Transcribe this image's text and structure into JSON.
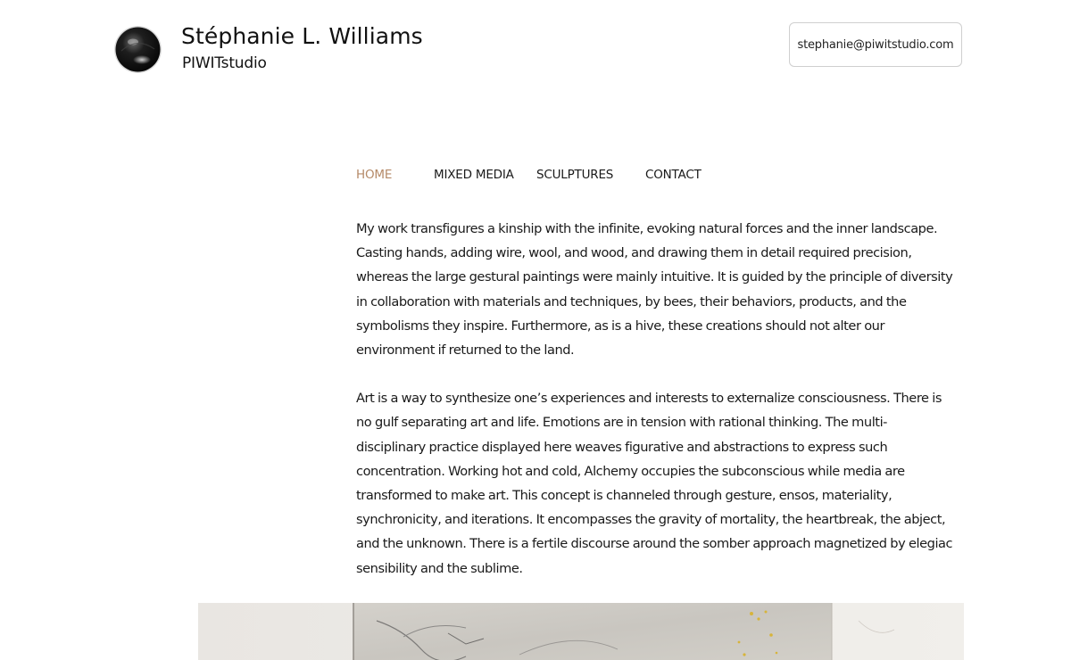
{
  "header": {
    "logo_icon": "glossy-black-sphere-logo-icon",
    "title": "Stéphanie L. Williams",
    "subtitle": "PIWITstudio",
    "email": "stephanie@piwitstudio.com"
  },
  "nav": {
    "items": [
      {
        "label": "HOME",
        "active": true
      },
      {
        "label": "MIXED MEDIA",
        "active": false
      },
      {
        "label": "SCULPTURES",
        "active": false
      },
      {
        "label": "CONTACT",
        "active": false
      }
    ]
  },
  "content": {
    "paragraphs": [
      "My work transfigures a kinship with the infinite, evoking natural forces and the inner landscape. Casting hands, adding wire, wool, and wood, and drawing them in detail required precision, whereas the large gestural paintings were mainly intuitive. It is guided by the principle of diversity in collaboration with materials and techniques, by bees, their behaviors, products, and the symbolisms they inspire. Furthermore, as is a hive, these creations should not alter our environment if returned to the land.",
      "Art is a way to synthesize one’s experiences and interests to externalize consciousness. There is no gulf separating art and life. Emotions are in tension with rational thinking. The multi-disciplinary practice displayed here weaves figurative and abstractions to express such concentration. Working hot and cold, Alchemy occupies the subconscious while media are transformed to make art. This concept is channeled through gesture, ensos, materiality, synchronicity, and iterations. It encompasses the gravity of mortality, the heartbreak, the abject, and the unknown. There is a fertile discourse around the somber approach magnetized by elegiac sensibility and the sublime."
    ]
  },
  "colors": {
    "accent": "#b58a68",
    "text": "#1a1a1a",
    "background": "#ffffff",
    "button_border": "#cfcfcf"
  }
}
